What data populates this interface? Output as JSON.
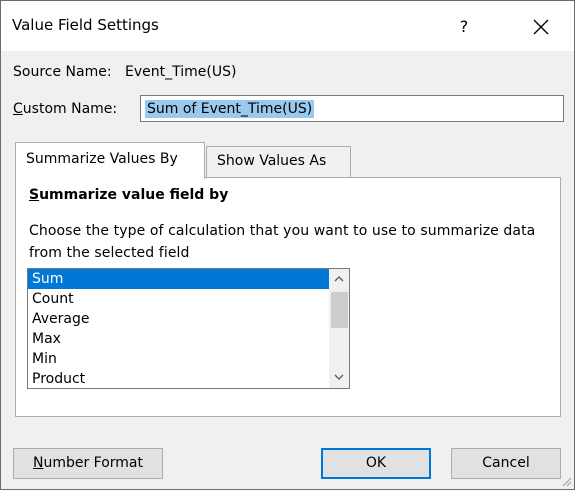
{
  "dialog": {
    "title": "Value Field Settings",
    "help_label": "?",
    "close_label": "close"
  },
  "source": {
    "label": "Source Name:",
    "value": "Event_Time(US)"
  },
  "custom_name": {
    "label_prefix": "C",
    "label_rest": "ustom Name:",
    "value": "Sum of Event_Time(US)"
  },
  "tabs": [
    {
      "label": "Summarize Values By",
      "active": true
    },
    {
      "label": "Show Values As",
      "active": false
    }
  ],
  "panel": {
    "heading_prefix": "S",
    "heading_rest": "ummarize value field by",
    "description": "Choose the type of calculation that you want to use to summarize data from the selected field"
  },
  "list": {
    "items": [
      "Sum",
      "Count",
      "Average",
      "Max",
      "Min",
      "Product"
    ],
    "selected": "Sum"
  },
  "buttons": {
    "number_format_prefix": "N",
    "number_format_rest": "umber Format",
    "ok": "OK",
    "cancel": "Cancel"
  }
}
